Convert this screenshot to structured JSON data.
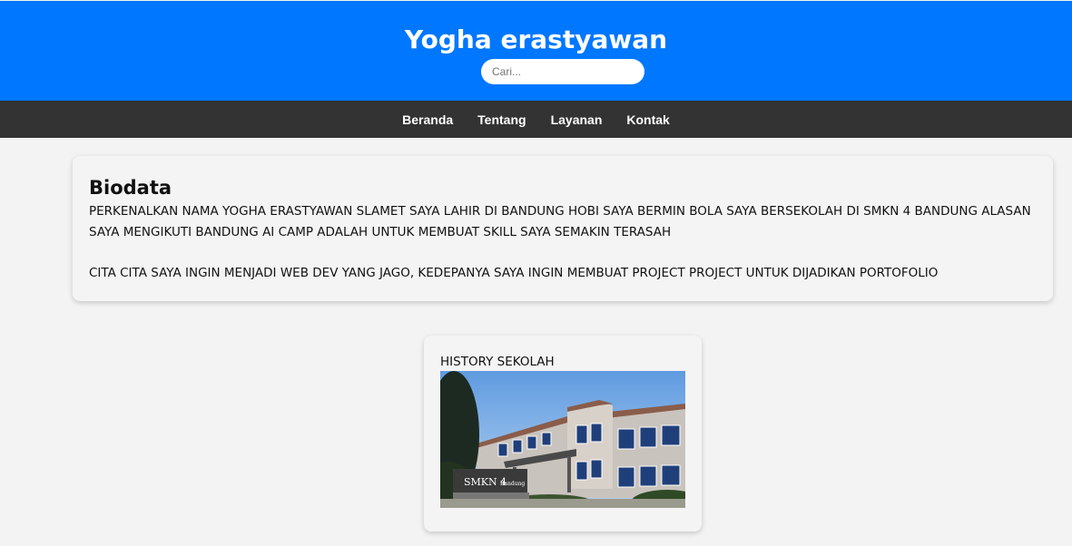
{
  "header": {
    "title": "Yogha erastyawan",
    "search_placeholder": "Cari...",
    "background_color": "#0077ff"
  },
  "nav": {
    "items": [
      {
        "label": "Beranda"
      },
      {
        "label": "Tentang"
      },
      {
        "label": "Layanan"
      },
      {
        "label": "Kontak"
      }
    ],
    "background_color": "#333333"
  },
  "biodata": {
    "heading": "Biodata",
    "paragraph1": "PERKENALKAN NAMA YOGHA ERASTYAWAN SLAMET SAYA LAHIR DI BANDUNG HOBI SAYA BERMIN BOLA SAYA BERSEKOLAH DI SMKN 4 BANDUNG ALASAN SAYA MENGIKUTI BANDUNG AI CAMP ADALAH UNTUK MEMBUAT SKILL SAYA SEMAKIN TERASAH",
    "paragraph2": "CITA CITA SAYA INGIN MENJADI WEB DEV YANG JAGO, KEDEPANYA SAYA INGIN MEMBUAT PROJECT PROJECT UNTUK DIJADIKAN PORTOFOLIO"
  },
  "history": {
    "label": "HISTORY SEKOLAH",
    "sign_text": "SMKN 4",
    "sign_subtext": "Bandung"
  }
}
